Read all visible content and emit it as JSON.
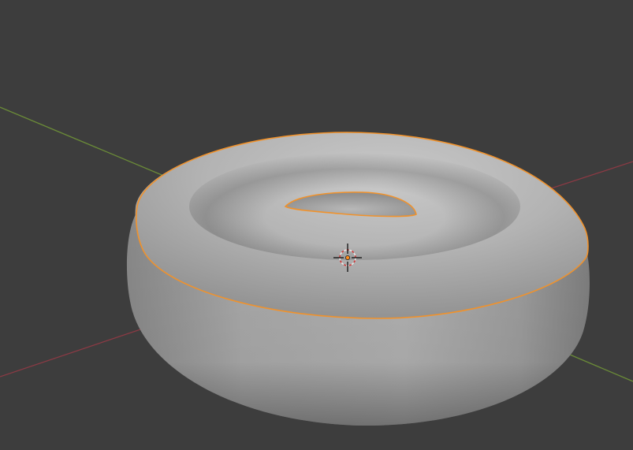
{
  "viewport": {
    "background_color": "#3d3d3d",
    "view": "perspective"
  },
  "axes": {
    "x_axis_color": "#8a3a44",
    "y_axis_color": "#6a8a38"
  },
  "object": {
    "type": "torus",
    "selected": true,
    "outline_color": "#f0922c",
    "surface_color": "#a6a6a6"
  },
  "origin_marker": {
    "icon": "crosshair-icon",
    "color": "#e8e8e8",
    "accent_color": "#ff8c1a"
  }
}
